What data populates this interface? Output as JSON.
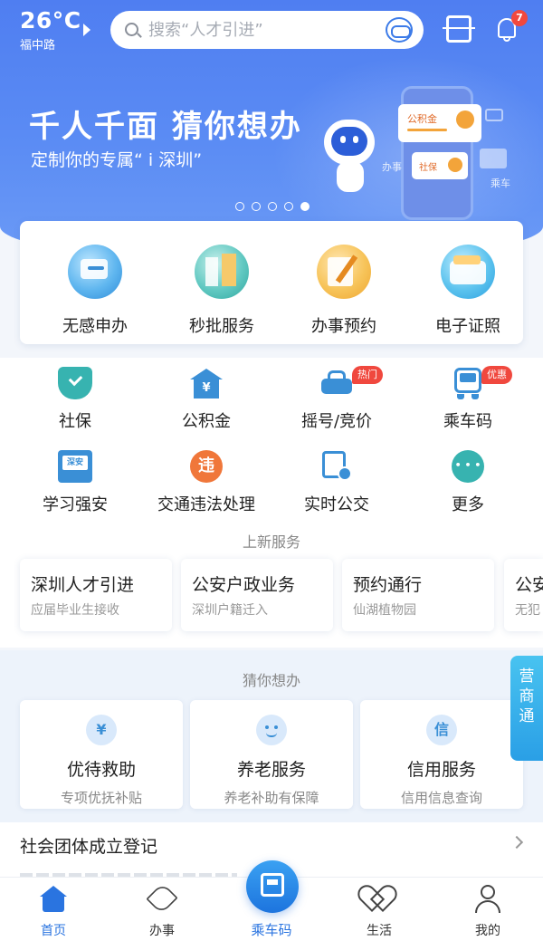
{
  "header": {
    "temperature": "26°C",
    "location": "福中路",
    "search_placeholder": "搜索“人才引进”",
    "notification_count": "7"
  },
  "banner": {
    "headline": "千人千面 猜你想办",
    "subline": "定制你的专属“ i 深圳”",
    "illustration_labels": [
      "公积金",
      "社保",
      "办事",
      "乘车"
    ],
    "page_count": 5,
    "active_page": 5
  },
  "featured": [
    {
      "label": "无感申办",
      "icon": "hand-card-icon"
    },
    {
      "label": "秒批服务",
      "icon": "building-icon"
    },
    {
      "label": "办事预约",
      "icon": "pen-calendar-icon"
    },
    {
      "label": "电子证照",
      "icon": "wallet-icon"
    }
  ],
  "services": [
    {
      "label": "社保",
      "icon": "shield-icon"
    },
    {
      "label": "公积金",
      "icon": "house-yuan-icon"
    },
    {
      "label": "摇号/竞价",
      "icon": "car-icon",
      "tag": "热门"
    },
    {
      "label": "乘车码",
      "icon": "bus-qr-icon",
      "tag": "优惠"
    },
    {
      "label": "学习强安",
      "icon": "book-icon",
      "icon_text": "深安"
    },
    {
      "label": "交通违法处理",
      "icon": "violation-icon",
      "icon_text": "违"
    },
    {
      "label": "实时公交",
      "icon": "bus-stop-icon"
    },
    {
      "label": "更多",
      "icon": "more-icon"
    }
  ],
  "new_services": {
    "title": "上新服务",
    "items": [
      {
        "title": "深圳人才引进",
        "subtitle": "应届毕业生接收"
      },
      {
        "title": "公安户政业务",
        "subtitle": "深圳户籍迁入"
      },
      {
        "title": "预约通行",
        "subtitle": "仙湖植物园"
      },
      {
        "title": "公安",
        "subtitle": "无犯"
      }
    ]
  },
  "guess": {
    "title": "猜你想办",
    "items": [
      {
        "title": "优待救助",
        "subtitle": "专项优抚补贴",
        "icon_text": "¥"
      },
      {
        "title": "养老服务",
        "subtitle": "养老补助有保障",
        "icon_text": ""
      },
      {
        "title": "信用服务",
        "subtitle": "信用信息查询",
        "icon_text": "信"
      }
    ]
  },
  "side_tab": "营商通",
  "list_row": "社会团体成立登记",
  "tabbar": [
    {
      "label": "首页",
      "icon": "home-icon",
      "active": true
    },
    {
      "label": "办事",
      "icon": "send-icon",
      "active": false
    },
    {
      "label": "乘车码",
      "icon": "bus-qr-icon",
      "active": false
    },
    {
      "label": "生活",
      "icon": "heart-icon",
      "active": false
    },
    {
      "label": "我的",
      "icon": "user-icon",
      "active": false
    }
  ],
  "colors": {
    "brand": "#4f7ef1",
    "accent": "#2a74e0",
    "badge": "#f0483e"
  }
}
